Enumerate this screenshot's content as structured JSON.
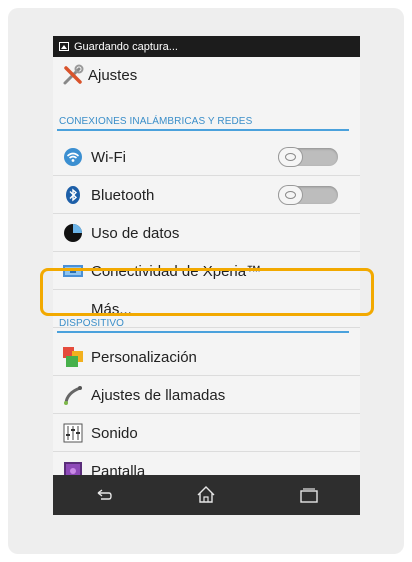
{
  "status_bar": {
    "text": "Guardando captura..."
  },
  "header": {
    "title": "Ajustes"
  },
  "sections": [
    {
      "title": "CONEXIONES INALÁMBRICAS Y REDES",
      "items": [
        {
          "label": "Wi-Fi",
          "icon": "wifi-icon",
          "toggle": "off"
        },
        {
          "label": "Bluetooth",
          "icon": "bluetooth-icon",
          "toggle": "off"
        },
        {
          "label": "Uso de datos",
          "icon": "data-usage-icon"
        },
        {
          "label": "Conectividad de Xperia™",
          "icon": "xperia-connectivity-icon"
        },
        {
          "label": "Más...",
          "icon": "",
          "highlighted": true
        }
      ]
    },
    {
      "title": "DISPOSITIVO",
      "items": [
        {
          "label": "Personalización",
          "icon": "personalization-icon"
        },
        {
          "label": "Ajustes de llamadas",
          "icon": "phone-handset-icon"
        },
        {
          "label": "Sonido",
          "icon": "equalizer-icon"
        },
        {
          "label": "Pantalla",
          "icon": "display-icon"
        }
      ]
    }
  ],
  "nav_bar": {
    "buttons": [
      "back-icon",
      "home-icon",
      "recent-apps-icon"
    ]
  },
  "colors": {
    "accent": "#4aa1dc",
    "highlight": "#f2a900",
    "status_bar": "#1c1c1c",
    "nav_bar": "#2e2e2e"
  }
}
